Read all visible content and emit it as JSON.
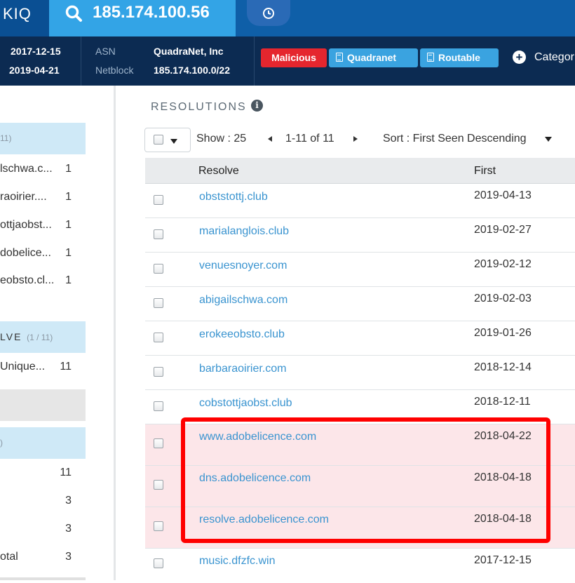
{
  "brand": {
    "text": "KIQ"
  },
  "search": {
    "query": "185.174.100.56"
  },
  "info": {
    "first_seen": "2017-12-15",
    "last_seen": "2019-04-21",
    "asn_label": "ASN",
    "asn_value": "QuadraNet, Inc",
    "netblock_label": "Netblock",
    "netblock_value": "185.174.100.0/22"
  },
  "tags": [
    {
      "label": "Malicious",
      "color": "#e5262e"
    },
    {
      "label": "Quadranet",
      "color": "#3aa3e0"
    },
    {
      "label": "Routable",
      "color": "#3aa3e0"
    }
  ],
  "category_label": "Categor",
  "left_panel": {
    "section1_count": "11)",
    "section1_items": [
      {
        "label": "lschwa.c...",
        "count": "1"
      },
      {
        "label": "raoirier....",
        "count": "1"
      },
      {
        "label": "ottjaobst...",
        "count": "1"
      },
      {
        "label": "dobelice...",
        "count": "1"
      },
      {
        "label": "eobsto.cl...",
        "count": "1"
      }
    ],
    "section2_title": "LVE",
    "section2_count": "(1 / 11)",
    "section2_items": [
      {
        "label": "Unique...",
        "count": "11"
      }
    ],
    "section3_count": ")",
    "section3_items": [
      {
        "label": "",
        "count": "11"
      },
      {
        "label": "",
        "count": "3"
      },
      {
        "label": "",
        "count": "3"
      },
      {
        "label": "otal",
        "count": "3"
      }
    ]
  },
  "resolutions": {
    "title": "RESOLUTIONS",
    "show_label": "Show : 25",
    "pagination": "1-11 of 11",
    "sort_label": "Sort : First Seen Descending",
    "columns": {
      "resolve": "Resolve",
      "first": "First"
    },
    "rows": [
      {
        "resolve": "obststottj.club",
        "first": "2019-04-13",
        "highlighted": false
      },
      {
        "resolve": "marialanglois.club",
        "first": "2019-02-27",
        "highlighted": false
      },
      {
        "resolve": "venuesnoyer.com",
        "first": "2019-02-12",
        "highlighted": false
      },
      {
        "resolve": "abigailschwa.com",
        "first": "2019-02-03",
        "highlighted": false
      },
      {
        "resolve": "erokeeobsto.club",
        "first": "2019-01-26",
        "highlighted": false
      },
      {
        "resolve": "barbaraoirier.com",
        "first": "2018-12-14",
        "highlighted": false
      },
      {
        "resolve": "cobstottjaobst.club",
        "first": "2018-12-11",
        "highlighted": false
      },
      {
        "resolve": "www.adobelicence.com",
        "first": "2018-04-22",
        "highlighted": true
      },
      {
        "resolve": "dns.adobelicence.com",
        "first": "2018-04-18",
        "highlighted": true
      },
      {
        "resolve": "resolve.adobelicence.com",
        "first": "2018-04-18",
        "highlighted": true
      },
      {
        "resolve": "music.dfzfc.win",
        "first": "2017-12-15",
        "highlighted": false
      }
    ]
  },
  "colors": {
    "topbar": "#0f5fa8",
    "search": "#33a4e6",
    "infobar": "#0c2b52",
    "link": "#3a94d0",
    "highlight_row": "#fce6e9",
    "annotation": "#ff0000"
  }
}
